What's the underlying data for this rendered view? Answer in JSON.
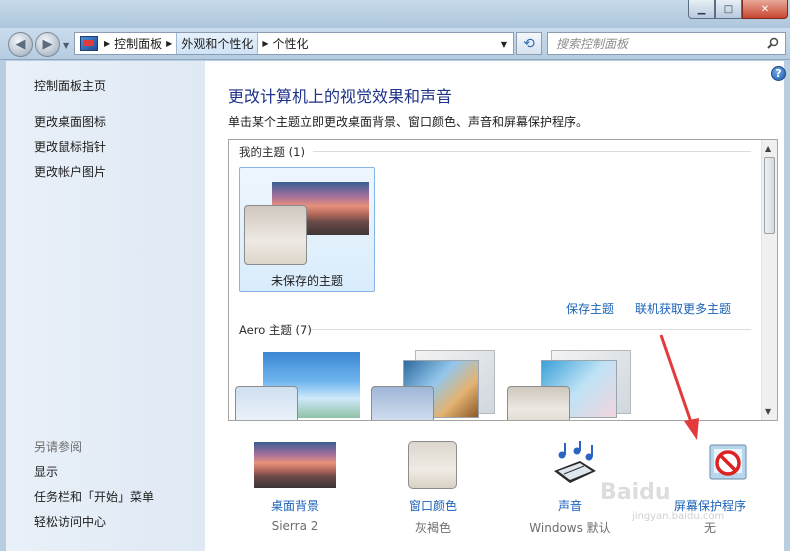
{
  "window": {
    "minimize_glyph": "▁",
    "maximize_glyph": "□",
    "close_glyph": "✕"
  },
  "address": {
    "back_glyph": "◀",
    "forward_glyph": "▶",
    "crumbs": [
      "控制面板",
      "外观和个性化",
      "个性化"
    ],
    "search_placeholder": "搜索控制面板"
  },
  "sidebar": {
    "home": "控制面板主页",
    "links": [
      "更改桌面图标",
      "更改鼠标指针",
      "更改帐户图片"
    ],
    "see_also_title": "另请参阅",
    "see_also": [
      "显示",
      "任务栏和「开始」菜单",
      "轻松访问中心"
    ]
  },
  "main": {
    "help_glyph": "?",
    "title": "更改计算机上的视觉效果和声音",
    "subtitle": "单击某个主题立即更改桌面背景、窗口颜色、声音和屏幕保护程序。",
    "my_themes_label": "我的主题 (1)",
    "unsaved_theme": "未保存的主题",
    "save_theme": "保存主题",
    "get_more_themes": "联机获取更多主题",
    "aero_label": "Aero 主题 (7)"
  },
  "settings": [
    {
      "name": "桌面背景",
      "value": "Sierra 2"
    },
    {
      "name": "窗口颜色",
      "value": "灰褐色"
    },
    {
      "name": "声音",
      "value": "Windows 默认"
    },
    {
      "name": "屏幕保护程序",
      "value": "无"
    }
  ],
  "watermark": {
    "brand": "Baidu",
    "sub": "jingyan.baidu.com"
  },
  "colors": {
    "link": "#1b62b8",
    "heading": "#1e3287",
    "arrow": "#e33b3b"
  }
}
